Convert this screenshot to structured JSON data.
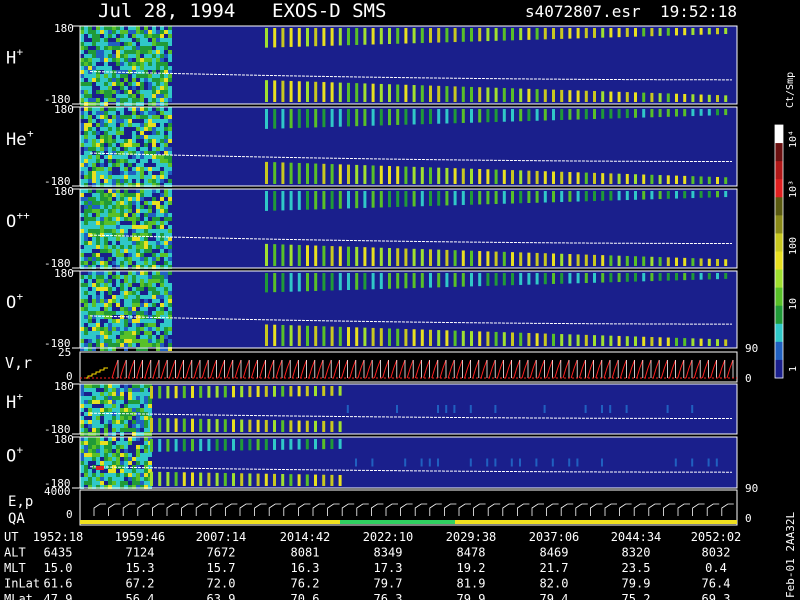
{
  "header": {
    "date": "Jul 28, 1994",
    "instrument": "EXOS-D SMS",
    "file": "s4072807.esr",
    "time": "19:52:18"
  },
  "colors": {
    "background": "#000000",
    "field": "#1a1f8c",
    "trace": "#ffffff",
    "velocity": "#ff2020",
    "qa_bar_yellow": "#f0e020",
    "qa_bar_green": "#30d060"
  },
  "chart_data": {
    "type": "heatmap",
    "panels": [
      {
        "label": "H",
        "sup": "+",
        "ymax": "180",
        "ymin": "-180"
      },
      {
        "label": "He",
        "sup": "+",
        "ymax": "180",
        "ymin": "-180"
      },
      {
        "label": "O",
        "sup": "++",
        "ymax": "180",
        "ymin": "-180"
      },
      {
        "label": "O",
        "sup": "+",
        "ymax": "180",
        "ymin": "-180"
      }
    ],
    "velocity_panel": {
      "label": "V,r",
      "ymax": "25",
      "ymin": "0",
      "right": "90",
      "right_low": "0"
    },
    "lower_panels": [
      {
        "label": "H",
        "sup": "+",
        "ymax": "180",
        "ymin": "-180"
      },
      {
        "label": "O",
        "sup": "+",
        "ymax": "180",
        "ymin": "-180"
      }
    ],
    "ep_panel": {
      "label1": "E,p",
      "label2": "QA",
      "ymax": "4000",
      "ymin": "0",
      "right": "90",
      "right_low": "0"
    },
    "colorbar": {
      "unit": "Ct/Smp",
      "ticks": [
        "10⁴",
        "10³",
        "100",
        "10",
        "1"
      ],
      "stops": [
        "#ffffff",
        "#6a1010",
        "#b01818",
        "#e02020",
        "#5a5a10",
        "#8a8a18",
        "#c8c820",
        "#e8e020",
        "#a0e030",
        "#58c028",
        "#209a38",
        "#30c8c8",
        "#2060c0",
        "#1a1f8c"
      ]
    },
    "time_axis": {
      "rows": [
        {
          "label": "UT",
          "values": [
            "1952:18",
            "1959:46",
            "2007:14",
            "2014:42",
            "2022:10",
            "2029:38",
            "2037:06",
            "2044:34",
            "2052:02"
          ]
        },
        {
          "label": "ALT",
          "values": [
            "6435",
            "7124",
            "7672",
            "8081",
            "8349",
            "8478",
            "8469",
            "8320",
            "8032"
          ]
        },
        {
          "label": "MLT",
          "values": [
            "15.0",
            "15.3",
            "15.7",
            "16.3",
            "17.3",
            "19.2",
            "21.7",
            "23.5",
            "0.4"
          ]
        },
        {
          "label": "InLat",
          "values": [
            "61.6",
            "67.2",
            "72.0",
            "76.2",
            "79.7",
            "81.9",
            "82.0",
            "79.9",
            "76.4"
          ]
        },
        {
          "label": "MLat",
          "values": [
            "47.9",
            "56.4",
            "63.9",
            "70.6",
            "76.3",
            "79.9",
            "79.4",
            "75.2",
            "69.3"
          ]
        }
      ]
    },
    "side_note": "Feb-01 2AA32L"
  }
}
